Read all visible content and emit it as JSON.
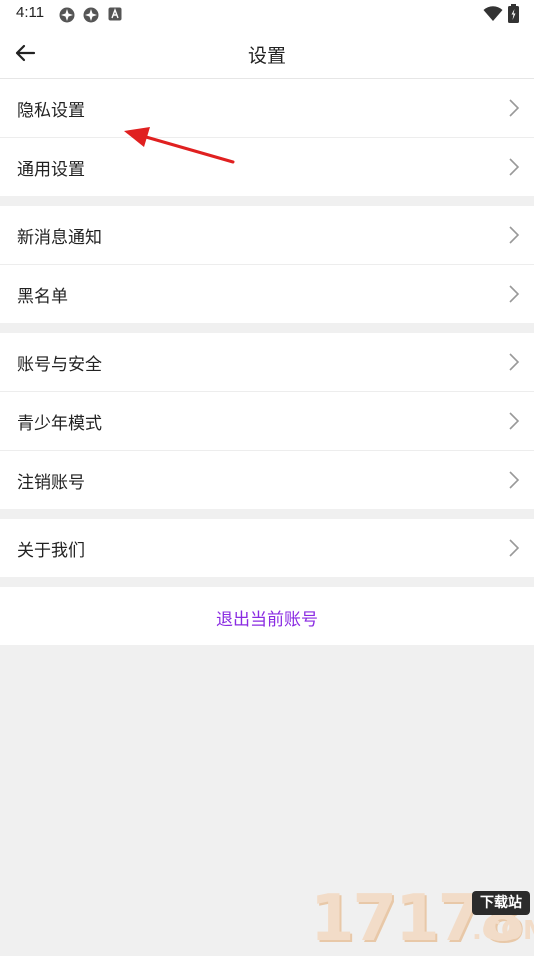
{
  "status_bar": {
    "time": "4:11",
    "icons": [
      "gear-icon",
      "gear-icon",
      "a-icon",
      "wifi-icon",
      "battery-icon"
    ]
  },
  "header": {
    "title": "设置",
    "back_icon": "back-arrow-icon"
  },
  "groups": [
    {
      "items": [
        {
          "label": "隐私设置"
        },
        {
          "label": "通用设置"
        }
      ]
    },
    {
      "items": [
        {
          "label": "新消息通知"
        },
        {
          "label": "黑名单"
        }
      ]
    },
    {
      "items": [
        {
          "label": "账号与安全"
        },
        {
          "label": "青少年模式"
        },
        {
          "label": "注销账号"
        }
      ]
    },
    {
      "items": [
        {
          "label": "关于我们"
        }
      ]
    }
  ],
  "logout": {
    "label": "退出当前账号",
    "color": "#8a2be2"
  },
  "annotation": {
    "arrow_color": "#e02020"
  },
  "watermark": {
    "digits": "17178",
    "badge": "下载站",
    "suffix": ".COM"
  }
}
